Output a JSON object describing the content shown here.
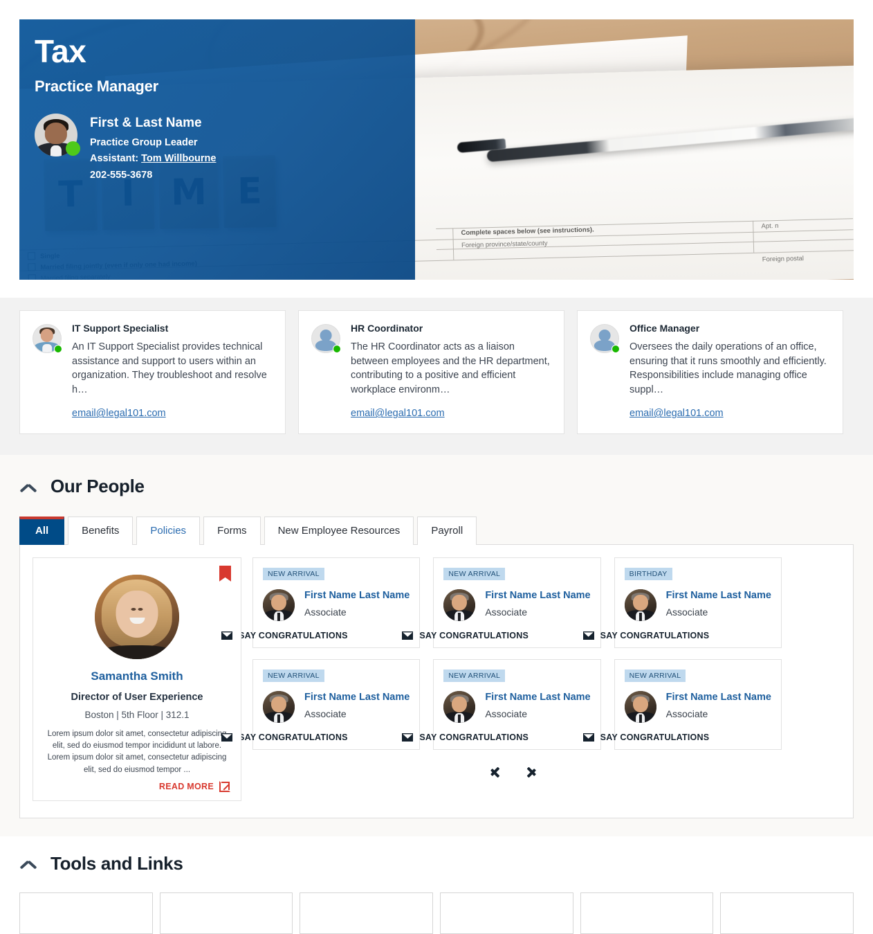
{
  "hero": {
    "title": "Tax",
    "subtitle": "Practice Manager",
    "person": {
      "name": "First & Last Name",
      "role": "Practice Group Leader",
      "assistant_label": "Assistant:",
      "assistant_name": "Tom Willbourne",
      "phone": "202-555-3678"
    },
    "image_tiles": [
      "T",
      "I",
      "M",
      "E"
    ],
    "image_form_texts": {
      "single": "Single",
      "married_joint": "Married filing jointly (even if only one had income)",
      "married_sep": "Married filing separately",
      "complete_spaces": "Complete spaces below (see instructions).",
      "foreign_province": "Foreign province/state/county",
      "foreign_postal": "Foreign postal",
      "apt": "Apt. n"
    }
  },
  "role_cards": [
    {
      "title": "IT Support Specialist",
      "description": "An IT Support Specialist provides technical assistance and support to users within an organization. They troubleshoot and resolve h…",
      "email": "email@legal101.com",
      "avatar": "photo-avatar"
    },
    {
      "title": "HR Coordinator",
      "description": "The HR Coordinator acts as a liaison between employees and the HR department, contributing to a positive and efficient workplace environm…",
      "email": "email@legal101.com",
      "avatar": "generic-avatar"
    },
    {
      "title": "Office Manager",
      "description": "Oversees the daily operations of an office, ensuring that it runs smoothly and efficiently. Responsibilities include managing office suppl…",
      "email": "email@legal101.com",
      "avatar": "generic-avatar"
    }
  ],
  "our_people": {
    "heading": "Our People",
    "tabs": [
      {
        "label": "All",
        "active": true
      },
      {
        "label": "Benefits",
        "active": false
      },
      {
        "label": "Policies",
        "active": false
      },
      {
        "label": "Forms",
        "active": false
      },
      {
        "label": "New Employee Resources",
        "active": false
      },
      {
        "label": "Payroll",
        "active": false
      }
    ],
    "featured": {
      "name": "Samantha Smith",
      "role": "Director of User Experience",
      "location": "Boston | 5th Floor | 312.1",
      "description": "Lorem ipsum dolor sit amet, consectetur adipiscing elit, sed do eiusmod tempor incididunt ut labore. Lorem ipsum dolor sit amet, consectetur adipiscing elit, sed do eiusmod tempor ...",
      "read_more": "READ MORE"
    },
    "cards": [
      {
        "badge": "NEW ARRIVAL",
        "name": "First Name Last Name",
        "role": "Associate",
        "action": "SAY CONGRATULATIONS"
      },
      {
        "badge": "NEW ARRIVAL",
        "name": "First Name Last Name",
        "role": "Associate",
        "action": "SAY CONGRATULATIONS"
      },
      {
        "badge": "BIRTHDAY",
        "name": "First Name Last Name",
        "role": "Associate",
        "action": "SAY CONGRATULATIONS"
      },
      {
        "badge": "NEW ARRIVAL",
        "name": "First Name Last Name",
        "role": "Associate",
        "action": "SAY CONGRATULATIONS"
      },
      {
        "badge": "NEW ARRIVAL",
        "name": "First Name Last Name",
        "role": "Associate",
        "action": "SAY CONGRATULATIONS"
      },
      {
        "badge": "NEW ARRIVAL",
        "name": "First Name Last Name",
        "role": "Associate",
        "action": "SAY CONGRATULATIONS"
      }
    ]
  },
  "tools_and_links": {
    "heading": "Tools and Links",
    "cards": [
      "",
      "",
      "",
      "",
      "",
      ""
    ]
  },
  "colors": {
    "brand_blue": "#004b87",
    "hero_blue": "#0d5aa0",
    "accent_red": "#c8392f",
    "link_red": "#d8392f",
    "link_blue": "#2b6cb0",
    "name_blue": "#1e5f9e",
    "badge_bg": "#bfd9ee",
    "badge_text": "#1f4f77",
    "status_green": "#4ec91b",
    "section_bg": "#faf9f7",
    "strip_bg": "#f2f2f2",
    "dark_navy": "#16222e"
  }
}
